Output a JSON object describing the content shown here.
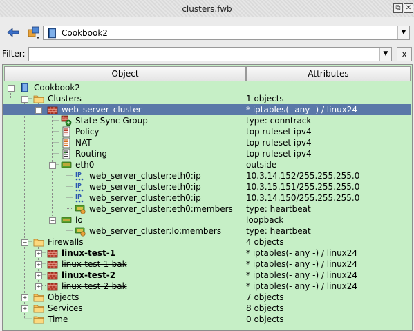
{
  "window": {
    "title": "clusters.fwb"
  },
  "toolbar": {
    "library": "Cookbook2"
  },
  "filter": {
    "label": "Filter:",
    "value": "",
    "clear_label": "x"
  },
  "tree": {
    "header": {
      "object": "Object",
      "attributes": "Attributes"
    },
    "rows": [
      {
        "label": "Cookbook2",
        "attr": ""
      },
      {
        "label": "Clusters",
        "attr": "1  objects"
      },
      {
        "label": "web_server_cluster",
        "attr": "* iptables(- any -) / linux24"
      },
      {
        "label": "State Sync Group",
        "attr": "type: conntrack"
      },
      {
        "label": "Policy",
        "attr": "top ruleset ipv4"
      },
      {
        "label": "NAT",
        "attr": "top ruleset ipv4"
      },
      {
        "label": "Routing",
        "attr": "top ruleset ipv4"
      },
      {
        "label": "eth0",
        "attr": "outside"
      },
      {
        "label": "web_server_cluster:eth0:ip",
        "attr": "10.3.14.152/255.255.255.0"
      },
      {
        "label": "web_server_cluster:eth0:ip",
        "attr": "10.3.15.151/255.255.255.0"
      },
      {
        "label": "web_server_cluster:eth0:ip",
        "attr": "10.3.14.150/255.255.255.0"
      },
      {
        "label": "web_server_cluster:eth0:members",
        "attr": "type: heartbeat"
      },
      {
        "label": "lo",
        "attr": "loopback"
      },
      {
        "label": "web_server_cluster:lo:members",
        "attr": "type: heartbeat"
      },
      {
        "label": "Firewalls",
        "attr": "4  objects"
      },
      {
        "label": "linux-test-1",
        "attr": "* iptables(- any -) / linux24"
      },
      {
        "label": "linux-test-1-bak",
        "attr": "* iptables(- any -) / linux24"
      },
      {
        "label": "linux-test-2",
        "attr": "* iptables(- any -) / linux24"
      },
      {
        "label": "linux-test-2-bak",
        "attr": "* iptables(- any -) / linux24"
      },
      {
        "label": "Objects",
        "attr": "7  objects"
      },
      {
        "label": "Services",
        "attr": "8  objects"
      },
      {
        "label": "Time",
        "attr": "0  objects"
      }
    ]
  }
}
